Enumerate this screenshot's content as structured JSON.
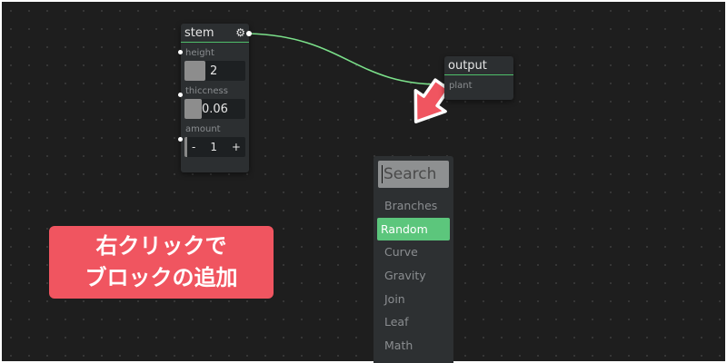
{
  "nodes": {
    "stem": {
      "title": "stem",
      "params": [
        {
          "label": "height",
          "value": "2",
          "fill": 0.45
        },
        {
          "label": "thiccness",
          "value": "0.06",
          "fill": 0.3
        }
      ],
      "amount": {
        "label": "amount",
        "minus": "-",
        "value": "1",
        "plus": "+"
      }
    },
    "output": {
      "title": "output",
      "input_label": "plant"
    }
  },
  "search_menu": {
    "placeholder": "Search",
    "items": [
      "Branches",
      "Random",
      "Curve",
      "Gravity",
      "Join",
      "Leaf",
      "Math"
    ],
    "active_item": "Random"
  },
  "callout": {
    "line1": "右クリックで",
    "line2": "ブロックの追加"
  },
  "colors": {
    "accent": "#5cc67c",
    "connection": "#7be08a",
    "arrow_fill": "#f05560",
    "callout_bg": "#f05560"
  },
  "icons": {
    "settings": "gear-icon",
    "pointer": "arrow-pointer-icon"
  }
}
